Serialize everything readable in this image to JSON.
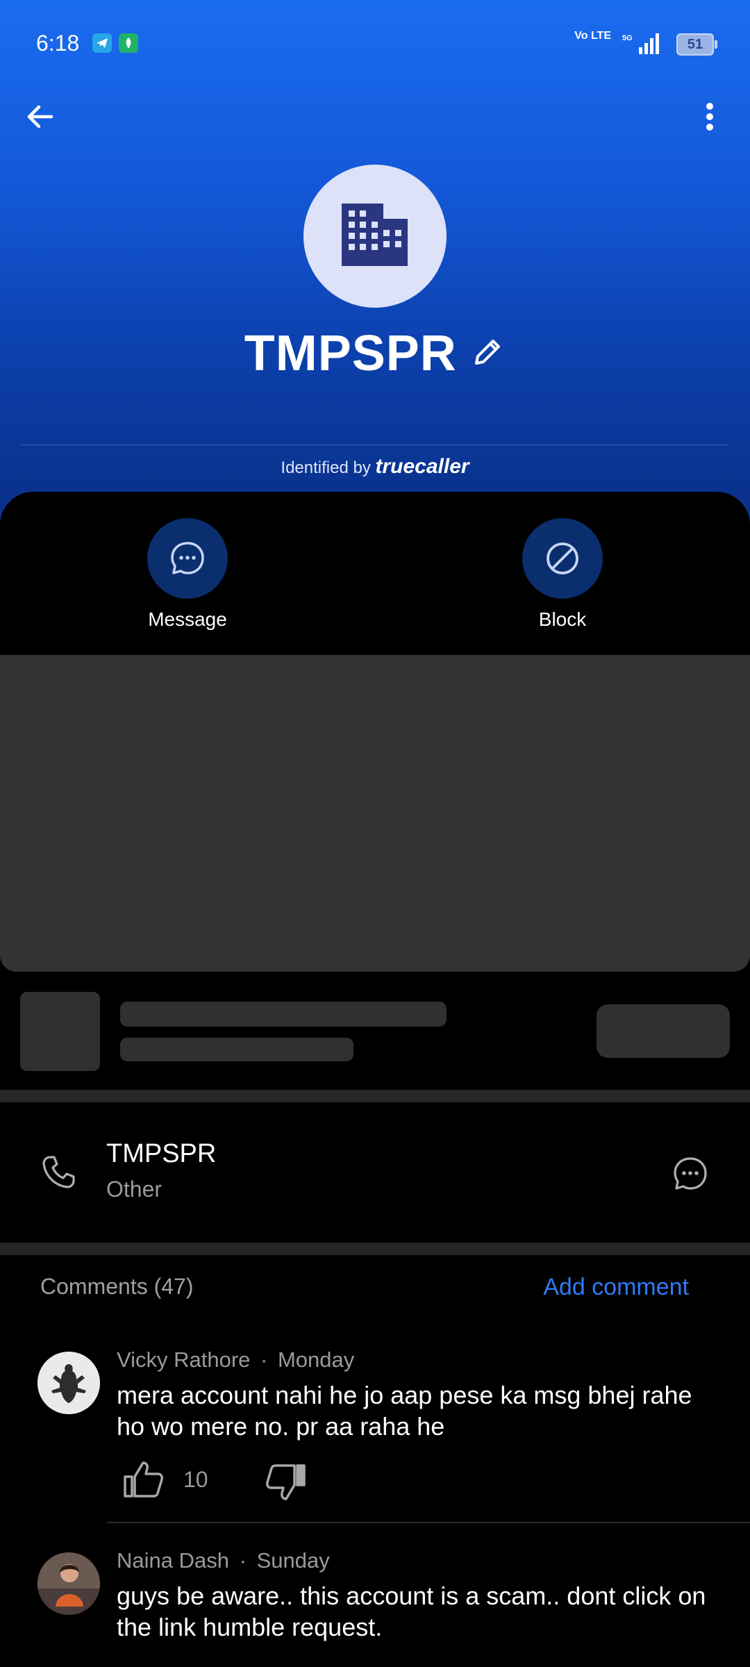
{
  "status_bar": {
    "time": "6:18",
    "network": "Vo LTE",
    "network_gen": "5G",
    "battery": "51"
  },
  "contact": {
    "name": "TMPSPR",
    "identified_prefix": "Identified by",
    "identified_brand": "truecaller"
  },
  "actions": {
    "message": "Message",
    "block": "Block"
  },
  "phone": {
    "number": "TMPSPR",
    "type": "Other"
  },
  "comments": {
    "title": "Comments (47)",
    "add_label": "Add comment",
    "items": [
      {
        "author": "Vicky Rathore",
        "separator": "·",
        "when": "Monday",
        "text": "mera account nahi he  jo aap pese ka msg bhej rahe ho wo mere no. pr aa raha he",
        "likes": "10"
      },
      {
        "author": "Naina Dash",
        "separator": "·",
        "when": "Sunday",
        "text": "guys be aware.. this account is a scam.. dont click on the link humble request."
      }
    ]
  },
  "colors": {
    "header_blue": "#1a6cf0",
    "accent": "#2d7cf6",
    "action_circle": "#0a2e6e"
  }
}
